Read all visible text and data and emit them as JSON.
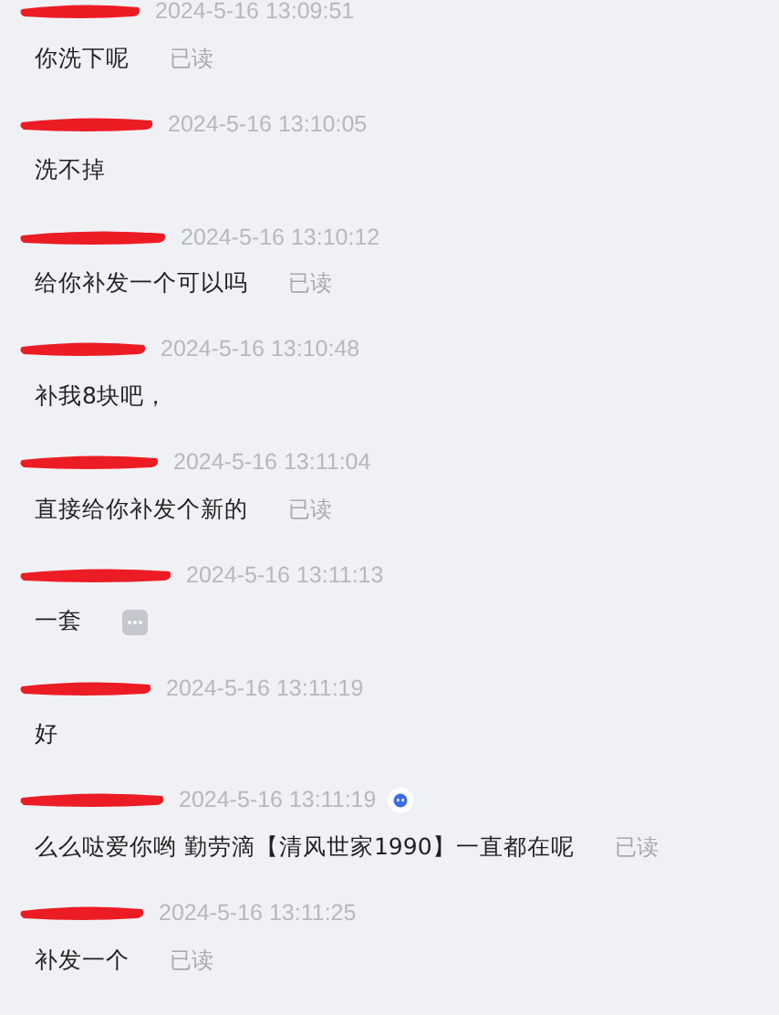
{
  "messages": [
    {
      "time": "2024-5-16 13:09:51",
      "text": "你洗下呢",
      "status": "已读"
    },
    {
      "time": "2024-5-16 13:10:05",
      "text": "洗不掉"
    },
    {
      "time": "2024-5-16 13:10:12",
      "text": "给你补发一个可以吗",
      "status": "已读"
    },
    {
      "time": "2024-5-16 13:10:48",
      "text": "补我8块吧，"
    },
    {
      "time": "2024-5-16 13:11:04",
      "text": "直接给你补发个新的",
      "status": "已读"
    },
    {
      "time": "2024-5-16 13:11:13",
      "text": "一套",
      "more_icon": true
    },
    {
      "time": "2024-5-16 13:11:19",
      "text": "好"
    },
    {
      "time": "2024-5-16 13:11:19",
      "text": "么么哒爱你哟  勤劳滴【清风世家1990】一直都在呢",
      "status": "已读",
      "badge": true
    },
    {
      "time": "2024-5-16 13:11:25",
      "text": "补发一个",
      "status": "已读"
    }
  ]
}
